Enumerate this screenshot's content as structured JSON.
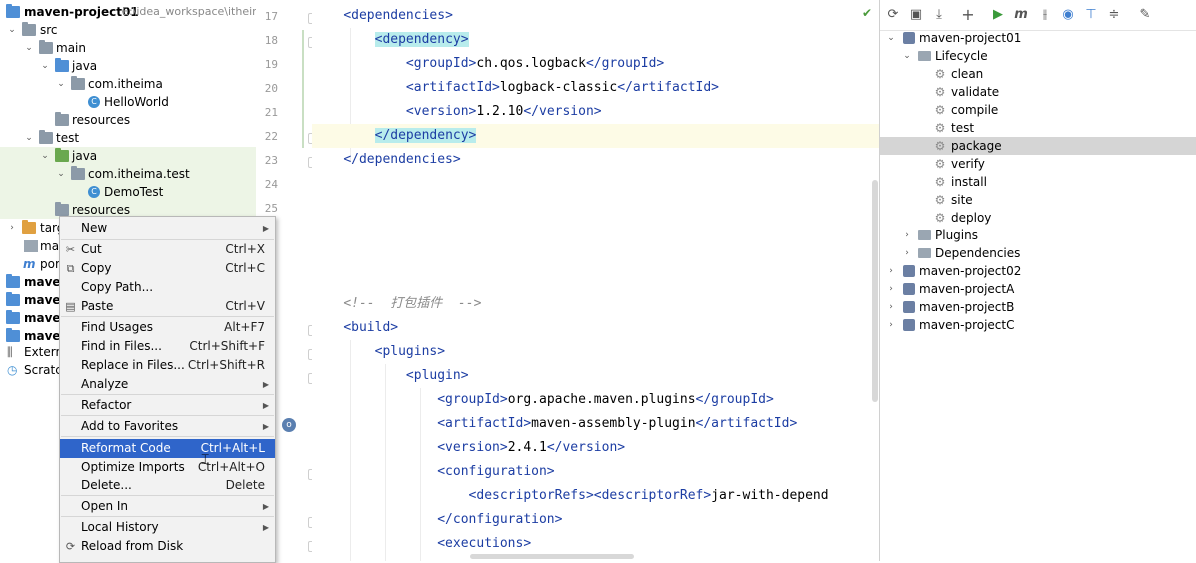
{
  "project_tree": {
    "root_label": "maven-project01",
    "root_path": "E:\\idea_workspace\\itheim",
    "items": [
      {
        "label": "src"
      },
      {
        "label": "main"
      },
      {
        "label": "java"
      },
      {
        "label": "com.itheima"
      },
      {
        "label": "HelloWorld"
      },
      {
        "label": "resources"
      },
      {
        "label": "test"
      },
      {
        "label": "java"
      },
      {
        "label": "com.itheima.test"
      },
      {
        "label": "DemoTest"
      },
      {
        "label": "resources"
      },
      {
        "label": "targ"
      },
      {
        "label": "mav"
      },
      {
        "label": "por"
      },
      {
        "label": "maven"
      },
      {
        "label": "maven"
      },
      {
        "label": "maven"
      },
      {
        "label": "maven"
      },
      {
        "label": "Externa"
      },
      {
        "label": "Scratch"
      }
    ]
  },
  "context_menu": {
    "items": [
      {
        "label": "New",
        "shortcut": ""
      },
      {
        "label": "Cut",
        "shortcut": "Ctrl+X"
      },
      {
        "label": "Copy",
        "shortcut": "Ctrl+C"
      },
      {
        "label": "Copy Path...",
        "shortcut": ""
      },
      {
        "label": "Paste",
        "shortcut": "Ctrl+V"
      },
      {
        "label": "Find Usages",
        "shortcut": "Alt+F7"
      },
      {
        "label": "Find in Files...",
        "shortcut": "Ctrl+Shift+F"
      },
      {
        "label": "Replace in Files...",
        "shortcut": "Ctrl+Shift+R"
      },
      {
        "label": "Analyze",
        "shortcut": ""
      },
      {
        "label": "Refactor",
        "shortcut": ""
      },
      {
        "label": "Add to Favorites",
        "shortcut": ""
      },
      {
        "label": "Reformat Code",
        "shortcut": "Ctrl+Alt+L"
      },
      {
        "label": "Optimize Imports",
        "shortcut": "Ctrl+Alt+O"
      },
      {
        "label": "Delete...",
        "shortcut": "Delete"
      },
      {
        "label": "Open In",
        "shortcut": ""
      },
      {
        "label": "Local History",
        "shortcut": ""
      },
      {
        "label": "Reload from Disk",
        "shortcut": ""
      }
    ],
    "selected": "Reformat Code"
  },
  "editor": {
    "line_numbers": [
      "17",
      "18",
      "19",
      "20",
      "21",
      "22",
      "23",
      "24",
      "25"
    ],
    "lines": {
      "l17": {
        "open": "<",
        "tag": "dependencies",
        "close": ">"
      },
      "l18": {
        "tag": "<dependency>"
      },
      "l19": {
        "o": "<groupId>",
        "v": "ch.qos.logback",
        "c": "</groupId>"
      },
      "l20": {
        "o": "<artifactId>",
        "v": "logback-classic",
        "c": "</artifactId>"
      },
      "l21": {
        "o": "<version>",
        "v": "1.2.10",
        "c": "</version>"
      },
      "l22": {
        "tag": "</dependency>"
      },
      "l23": {
        "tag": "</dependencies>"
      },
      "comment": "<!--  打包插件  -->",
      "build": "<build>",
      "plugins": "<plugins>",
      "plugin": "<plugin>",
      "p_group": {
        "o": "<groupId>",
        "v": "org.apache.maven.plugins",
        "c": "</groupId>"
      },
      "p_artifact": {
        "o": "<artifactId>",
        "v": "maven-assembly-plugin",
        "c": "</artifactId>"
      },
      "p_version": {
        "o": "<version>",
        "v": "2.4.1",
        "c": "</version>"
      },
      "configuration": "<configuration>",
      "descriptor": {
        "o": "<descriptorRefs><descriptorRef>",
        "v": "jar-with-depend"
      },
      "configuration_close": "</configuration>",
      "executions": "<executions>"
    }
  },
  "maven_panel": {
    "toolbar_icons": [
      "refresh-icon",
      "add-maven-project-icon",
      "download-icon",
      "add-icon",
      "run-icon",
      "execute-goal-icon",
      "toggle-offline-icon",
      "skip-tests-icon",
      "show-dependencies-icon",
      "collapse-all-icon",
      "settings-icon"
    ],
    "tree": [
      {
        "label": "maven-project01",
        "level": 0
      },
      {
        "label": "Lifecycle",
        "level": 1
      },
      {
        "label": "clean",
        "level": 2
      },
      {
        "label": "validate",
        "level": 2
      },
      {
        "label": "compile",
        "level": 2
      },
      {
        "label": "test",
        "level": 2
      },
      {
        "label": "package",
        "level": 2
      },
      {
        "label": "verify",
        "level": 2
      },
      {
        "label": "install",
        "level": 2
      },
      {
        "label": "site",
        "level": 2
      },
      {
        "label": "deploy",
        "level": 2
      },
      {
        "label": "Plugins",
        "level": 1
      },
      {
        "label": "Dependencies",
        "level": 1
      },
      {
        "label": "maven-project02",
        "level": 0
      },
      {
        "label": "maven-projectA",
        "level": 0
      },
      {
        "label": "maven-projectB",
        "level": 0
      },
      {
        "label": "maven-projectC",
        "level": 0
      }
    ],
    "selected": "package"
  }
}
